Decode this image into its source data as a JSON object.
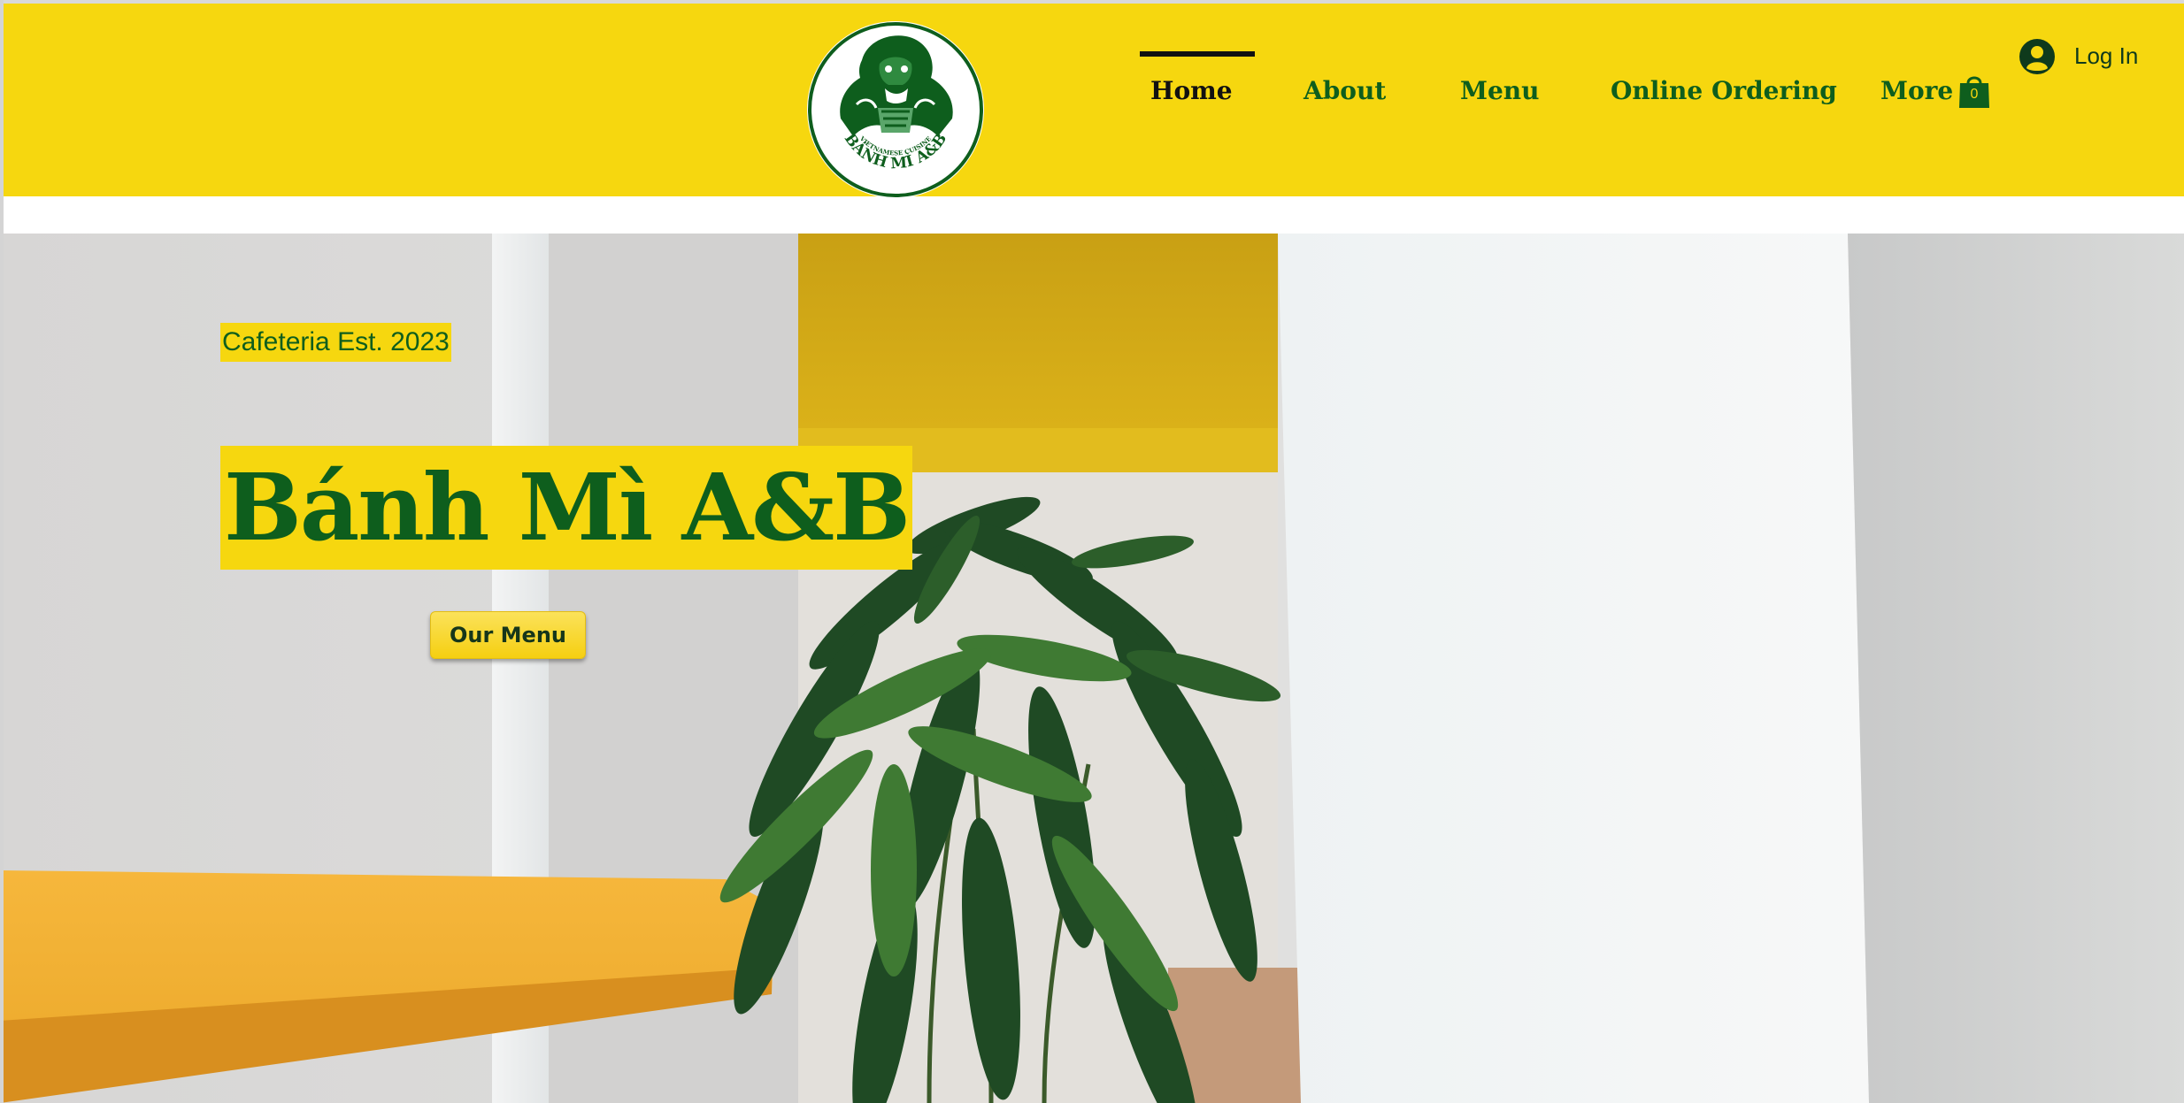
{
  "header": {
    "logo_text": "BÁNH MÌ A&B",
    "logo_subtext": "VIETNAMESE CUISINE",
    "nav": [
      {
        "label": "Home",
        "active": true
      },
      {
        "label": "About",
        "active": false
      },
      {
        "label": "Menu",
        "active": false
      },
      {
        "label": "Online Ordering",
        "active": false
      },
      {
        "label": "More",
        "active": false
      }
    ],
    "cart_count": "0",
    "cart_icon": "shopping-bag-icon",
    "login_label": "Log In",
    "login_icon": "user-avatar-icon"
  },
  "hero": {
    "tagline": "Cafeteria Est. 2023",
    "title": "Bánh Mì A&B",
    "button_label": "Our Menu"
  },
  "colors": {
    "brand_yellow": "#f6d70f",
    "brand_green": "#0e5e1d",
    "nav_active": "#111111"
  }
}
